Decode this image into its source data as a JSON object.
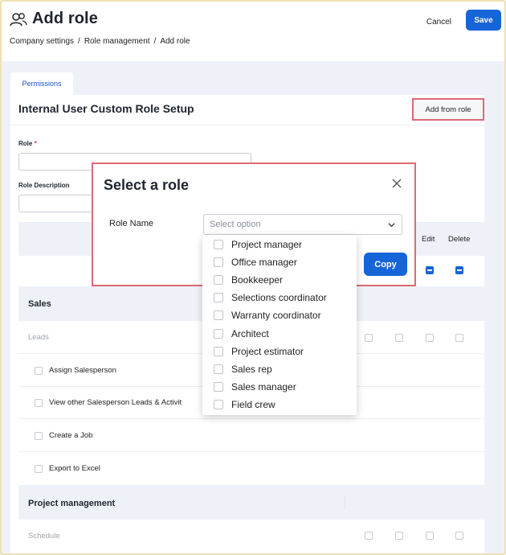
{
  "header": {
    "title": "Add role",
    "cancel_label": "Cancel",
    "save_label": "Save",
    "breadcrumb": [
      "Company settings",
      "Role management",
      "Add role"
    ]
  },
  "tabs": [
    {
      "label": "Permissions",
      "active": true
    }
  ],
  "card": {
    "title": "Internal User Custom Role Setup",
    "add_from_role_label": "Add from role",
    "role_label": "Role",
    "role_required_mark": "*",
    "role_value": "",
    "role_description_label": "Role Description",
    "role_description_value": ""
  },
  "columns": [
    "Edit",
    "Delete"
  ],
  "sections": [
    {
      "title": "Sales",
      "group": "Leads",
      "rows": [
        "Assign Salesperson",
        "View other Salesperson Leads & Activit",
        "Create a Job",
        "Export to Excel"
      ]
    },
    {
      "title": "Project management",
      "group": "Schedule",
      "rows": []
    }
  ],
  "modal": {
    "title": "Select a role",
    "role_name_label": "Role Name",
    "select_placeholder": "Select option",
    "copy_label": "Copy",
    "options": [
      "Project manager",
      "Office manager",
      "Bookkeeper",
      "Selections coordinator",
      "Warranty coordinator",
      "Architect",
      "Project estimator",
      "Sales rep",
      "Sales manager",
      "Field crew"
    ]
  },
  "colors": {
    "primary": "#1565d8",
    "highlight_border": "#dc6a73",
    "band_bg": "#eef2f8"
  }
}
